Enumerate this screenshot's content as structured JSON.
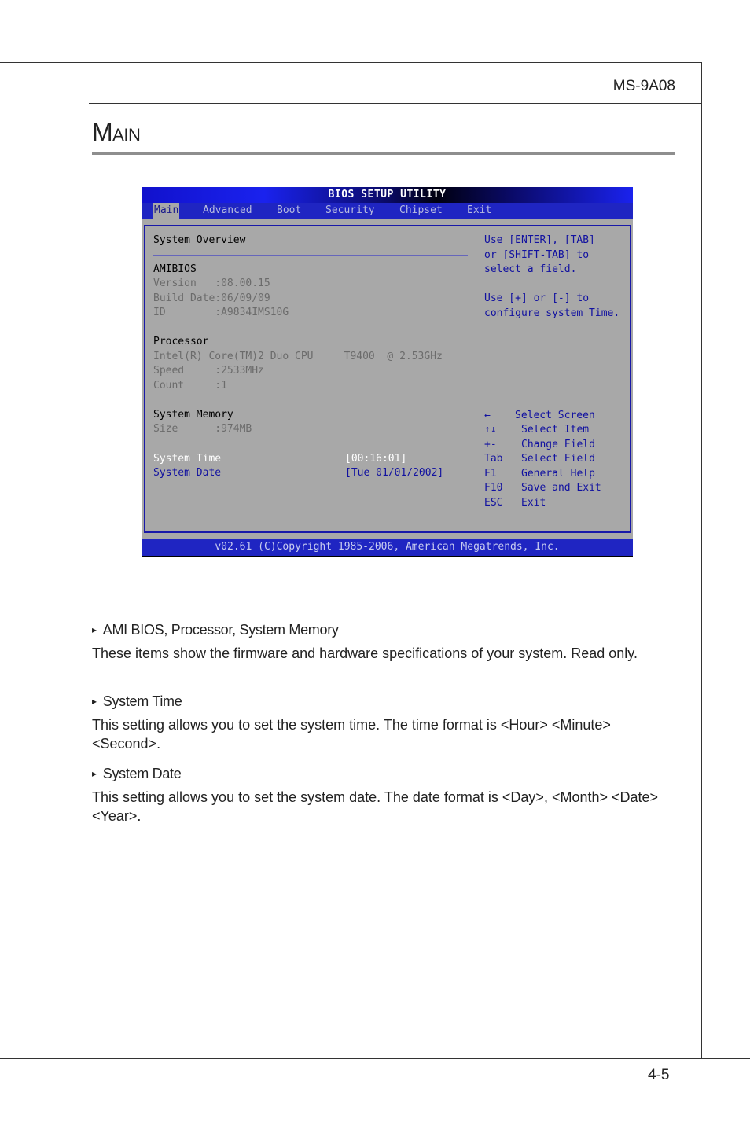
{
  "header": {
    "model": "MS-9A08"
  },
  "section": {
    "title_first": "M",
    "title_rest": "AIN"
  },
  "bios": {
    "title": "BIOS SETUP UTILITY",
    "menu": [
      "Main",
      "Advanced",
      "Boot",
      "Security",
      "Chipset",
      "Exit"
    ],
    "active_menu": "Main",
    "overview_title": "System Overview",
    "amibios": {
      "label": "AMIBIOS",
      "version": "Version   :08.00.15",
      "build_date": "Build Date:06/09/09",
      "id": "ID        :A9834IMS10G"
    },
    "processor": {
      "label": "Processor",
      "name": "Intel(R) Core(TM)2 Duo CPU     T9400  @ 2.53GHz",
      "speed": "Speed     :2533MHz",
      "count": "Count     :1"
    },
    "memory": {
      "label": "System Memory",
      "size": "Size      :974MB"
    },
    "system_time": {
      "label": "System Time",
      "value": "[00:16:01]"
    },
    "system_date": {
      "label": "System Date",
      "value": "[Tue 01/01/2002]"
    },
    "help": [
      "Use [ENTER], [TAB]",
      "or [SHIFT-TAB] to",
      "select a field.",
      "",
      "Use [+] or [-] to",
      "configure system Time."
    ],
    "keys": [
      {
        "key": "←",
        "desc": "Select Screen"
      },
      {
        "key": "↑↓",
        "desc": "Select Item"
      },
      {
        "key": "+-",
        "desc": "Change Field"
      },
      {
        "key": "Tab",
        "desc": "Select Field"
      },
      {
        "key": "F1",
        "desc": "General Help"
      },
      {
        "key": "F10",
        "desc": "Save and Exit"
      },
      {
        "key": "ESC",
        "desc": "Exit"
      }
    ],
    "footer": "v02.61 (C)Copyright 1985-2006, American Megatrends, Inc."
  },
  "items": [
    {
      "heading": "AMI BIOS, Processor, System Memory",
      "text": "These items show the firmware and hardware specifications of your system. Read only."
    },
    {
      "heading": "System Time",
      "text": "This setting allows you to set the system time. The time format is <Hour> <Minute> <Second>."
    },
    {
      "heading": "System Date",
      "text": "This setting allows you to set the system date. The date format is <Day>, <Month> <Date> <Year>."
    }
  ],
  "bullet_glyph": "▸",
  "footer": {
    "page_number": "4-5"
  }
}
